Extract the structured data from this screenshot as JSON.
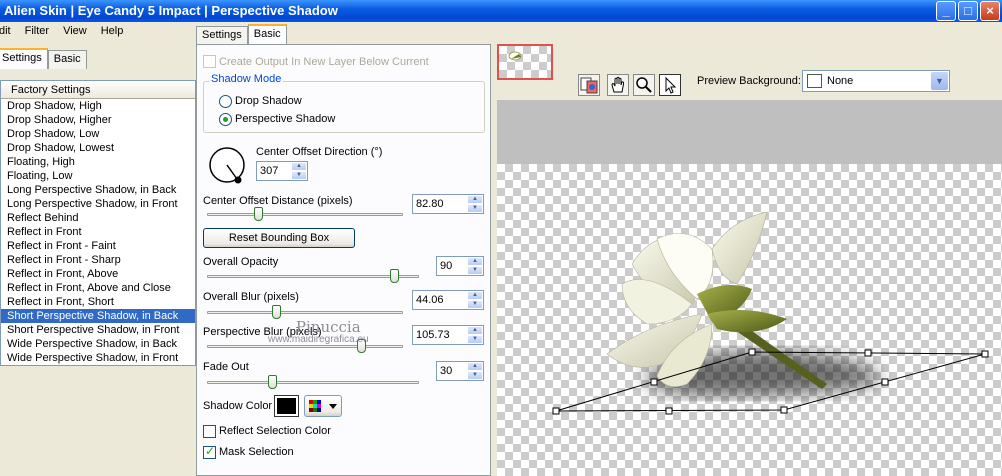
{
  "window": {
    "title": "Alien Skin | Eye Candy 5 Impact | Perspective Shadow",
    "min_label": "_",
    "max_label": "□",
    "close_label": "×"
  },
  "menu": [
    "dit",
    "Filter",
    "View",
    "Help"
  ],
  "left_tabs": [
    "Settings",
    "Basic"
  ],
  "settings_list": {
    "header": "Factory Settings",
    "items": [
      "Drop Shadow, High",
      "Drop Shadow, Higher",
      "Drop Shadow, Low",
      "Drop Shadow, Lowest",
      "Floating, High",
      "Floating, Low",
      "Long Perspective Shadow, in Back",
      "Long Perspective Shadow, in Front",
      "Reflect Behind",
      "Reflect in Front",
      "Reflect in Front - Faint",
      "Reflect in Front - Sharp",
      "Reflect in Front, Above",
      "Reflect in Front, Above and Close",
      "Reflect in Front, Short",
      "Short Perspective Shadow, in Back",
      "Short Perspective Shadow, in Front",
      "Wide Perspective Shadow, in Back",
      "Wide Perspective Shadow, in Front"
    ],
    "selected_index": 15
  },
  "mid_tabs": [
    "Settings",
    "Basic"
  ],
  "basic": {
    "create_output_label": "Create Output In New Layer Below Current",
    "shadow_mode_title": "Shadow Mode",
    "mode_drop": "Drop Shadow",
    "mode_perspective": "Perspective Shadow",
    "direction_label": "Center Offset Direction (°)",
    "direction_value": "307",
    "distance_label": "Center Offset Distance (pixels)",
    "distance_value": "82.80",
    "distance_slider": 0.25,
    "reset_label": "Reset Bounding Box",
    "opacity_label": "Overall Opacity",
    "opacity_value": "90",
    "opacity_slider": 0.9,
    "blur_label": "Overall Blur (pixels)",
    "blur_value": "44.06",
    "blur_slider": 0.35,
    "pblur_label": "Perspective Blur (pixels)",
    "pblur_value": "105.73",
    "pblur_slider": 0.8,
    "fade_label": "Fade Out",
    "fade_value": "30",
    "fade_slider": 0.3,
    "shadow_color_label": "Shadow Color",
    "shadow_color": "#000000",
    "reflect_label": "Reflect Selection Color",
    "mask_label": "Mask Selection"
  },
  "watermark": {
    "name": "Pinuccia",
    "url": "www.maidiregrafica.eu"
  },
  "preview": {
    "background_label": "Preview Background:",
    "background_value": "None",
    "tools": [
      "preview-toggle-icon",
      "hand-icon",
      "zoom-icon",
      "arrow-pointer-icon"
    ]
  }
}
